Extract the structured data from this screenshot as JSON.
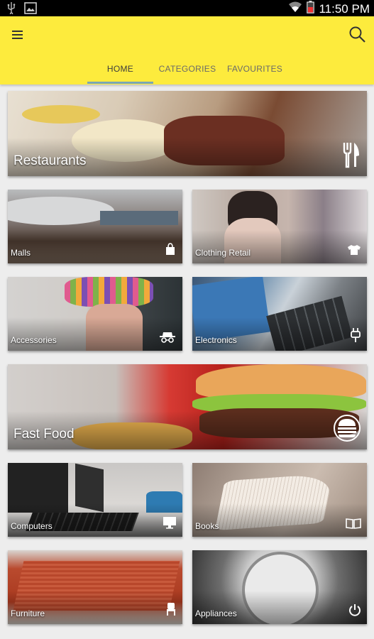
{
  "status_bar": {
    "time": "11:50 PM",
    "icons": [
      "usb-icon",
      "image-icon",
      "wifi-icon",
      "battery-low-icon"
    ]
  },
  "app_bar": {
    "menu_icon": "hamburger-menu-icon",
    "search_icon": "search-icon",
    "background": "#fdeb3d",
    "tabs": [
      {
        "label": "HOME",
        "active": true
      },
      {
        "label": "CATEGORIES",
        "active": false
      },
      {
        "label": "FAVOURITES",
        "active": false
      }
    ]
  },
  "categories": [
    {
      "name": "Restaurants",
      "icon": "fork-knife-icon"
    },
    {
      "name": "Malls",
      "icon": "shopping-bag-icon"
    },
    {
      "name": "Clothing Retail",
      "icon": "tshirt-icon"
    },
    {
      "name": "Accessories",
      "icon": "glasses-hat-icon"
    },
    {
      "name": "Electronics",
      "icon": "plug-icon"
    },
    {
      "name": "Fast Food",
      "icon": "burger-icon"
    },
    {
      "name": "Computers",
      "icon": "monitor-icon"
    },
    {
      "name": "Books",
      "icon": "open-book-icon"
    },
    {
      "name": "Furniture",
      "icon": "chair-icon"
    },
    {
      "name": "Appliances",
      "icon": "power-icon"
    }
  ]
}
